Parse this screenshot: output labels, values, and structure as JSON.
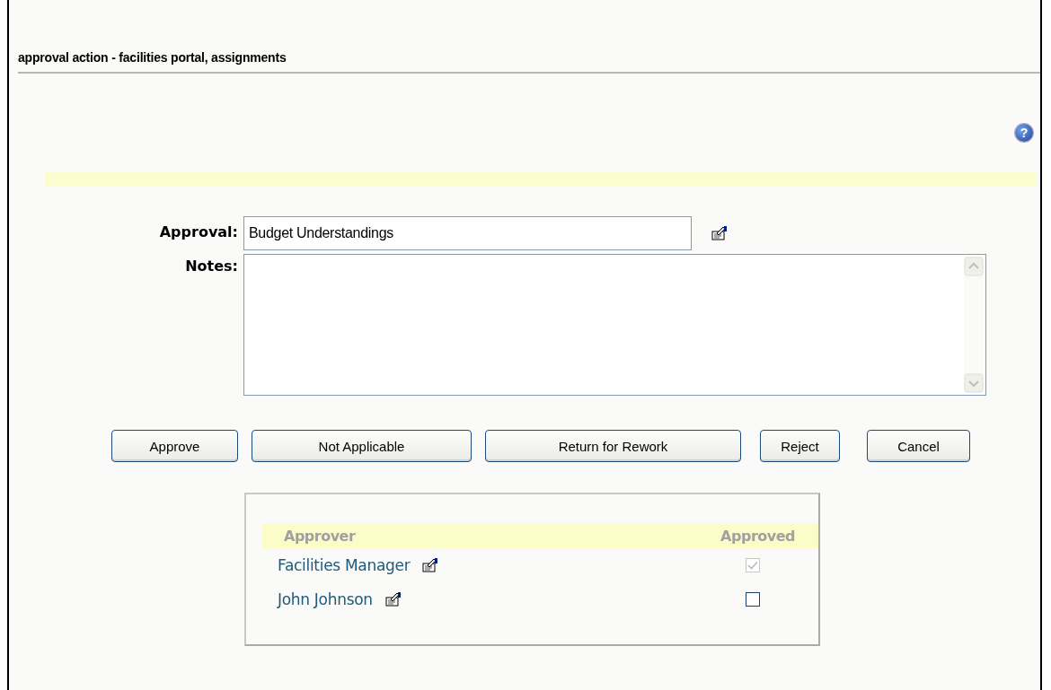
{
  "window": {
    "title": "approval action - facilities portal, assignments"
  },
  "help": {
    "glyph": "?"
  },
  "form": {
    "approval_label": "Approval:",
    "approval_value": "Budget Understandings",
    "notes_label": "Notes:"
  },
  "buttons": [
    "Approve",
    "Not Applicable",
    "Return for Rework",
    "Reject",
    "Cancel"
  ],
  "approvers": {
    "columns": [
      "Approver",
      "Approved"
    ],
    "rows": [
      {
        "name": "Facilities Manager",
        "approved": true,
        "disabled": true
      },
      {
        "name": "John Johnson",
        "approved": false,
        "disabled": false
      }
    ]
  }
}
